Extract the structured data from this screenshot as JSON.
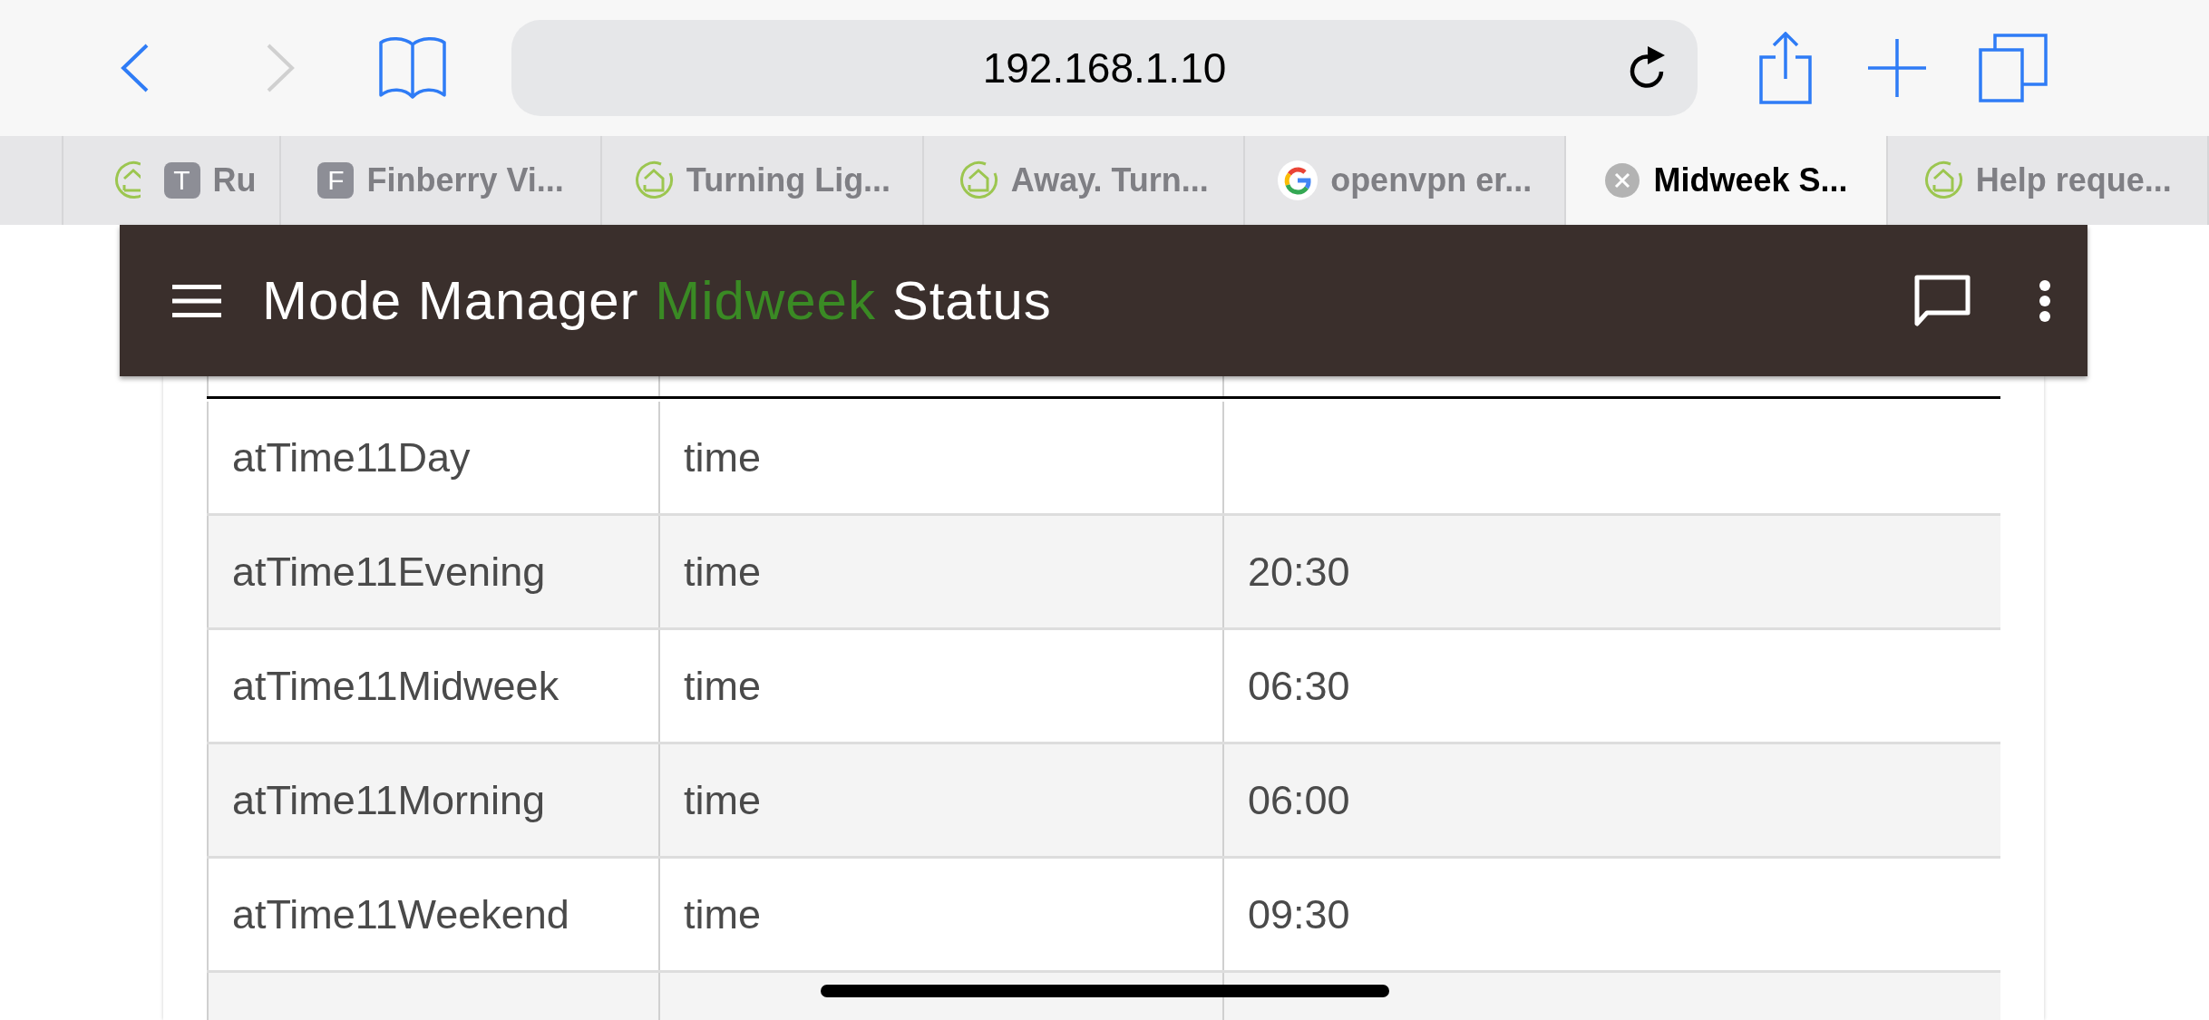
{
  "toolbar": {
    "back": {
      "disabled": false
    },
    "forward": {
      "disabled": true
    },
    "address": "192.168.1.10"
  },
  "tabs": [
    {
      "kind": "hubitat",
      "selected": false
    },
    {
      "kind": "letter",
      "letter": "T",
      "label": "Ru",
      "selected": false
    },
    {
      "kind": "letter",
      "letter": "F",
      "label": "Finberry Vi...",
      "selected": false
    },
    {
      "kind": "hubitat",
      "label": "Turning Lig...",
      "selected": false
    },
    {
      "kind": "hubitat",
      "label": "Away. Turn...",
      "selected": false
    },
    {
      "kind": "google",
      "label": "openvpn er...",
      "selected": false
    },
    {
      "kind": "close",
      "label": "Midweek S...",
      "selected": true
    },
    {
      "kind": "hubitat",
      "label": "Help reque...",
      "selected": false
    }
  ],
  "header": {
    "title": {
      "prefix": "Mode Manager",
      "highlight": "Midweek",
      "suffix": "Status"
    }
  },
  "table": {
    "rows": [
      {
        "name": "atTime11Day",
        "type": "time"
      },
      {
        "name": "atTime11Evening",
        "type": "time",
        "value": "20:30"
      },
      {
        "name": "atTime11Midweek",
        "type": "time",
        "value": "06:30"
      },
      {
        "name": "atTime11Morning",
        "type": "time",
        "value": "06:00"
      },
      {
        "name": "atTime11Weekend",
        "type": "time",
        "value": "09:30"
      }
    ]
  }
}
